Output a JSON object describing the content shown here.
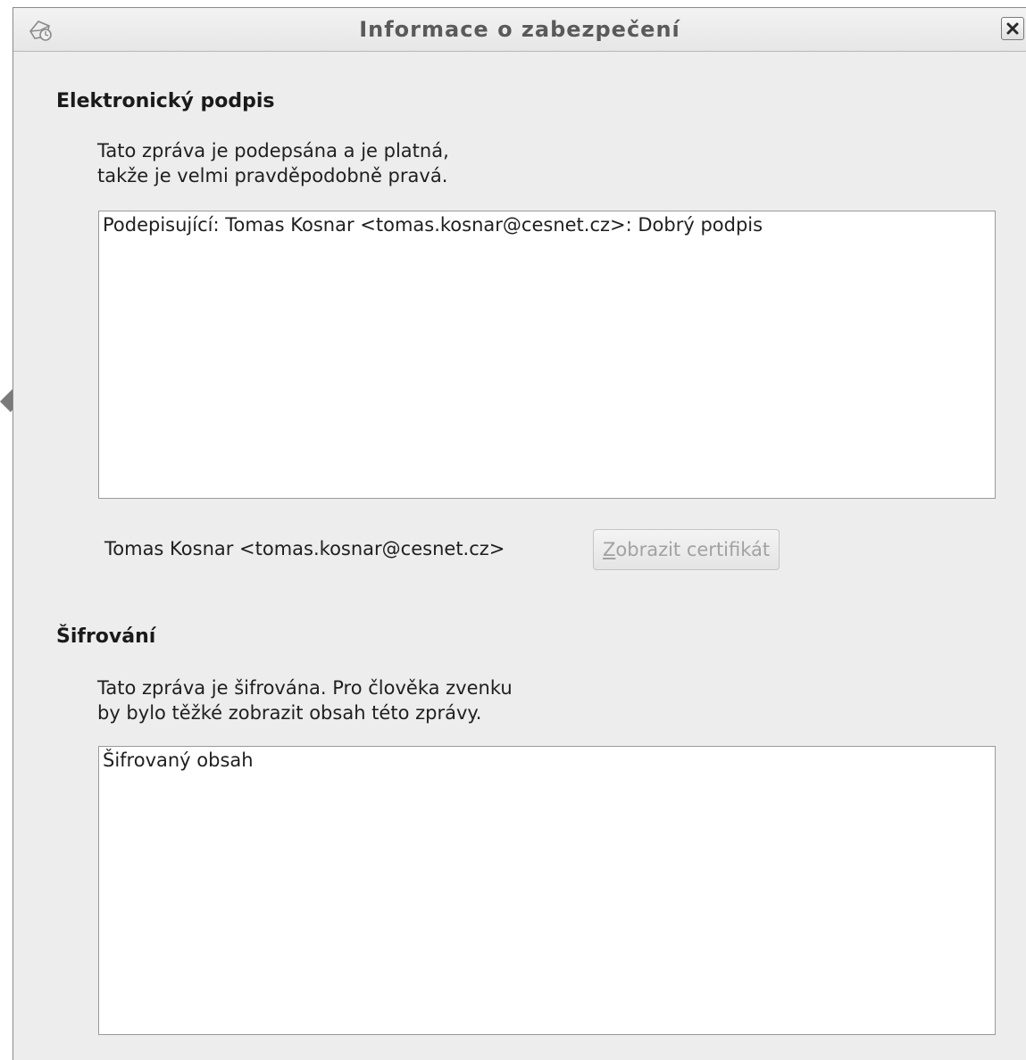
{
  "window": {
    "title": "Informace o zabezpečení",
    "close_label": "×"
  },
  "signature": {
    "heading": "Elektronický podpis",
    "description_line1": "Tato zpráva je podepsána a je platná,",
    "description_line2": "takže je velmi pravděpodobně pravá.",
    "details": "Podepisující: Tomas Kosnar <tomas.kosnar@cesnet.cz>: Dobrý podpis",
    "signer": "Tomas Kosnar <tomas.kosnar@cesnet.cz>",
    "view_cert_button": {
      "mnemonic": "Z",
      "rest": "obrazit certifikát"
    }
  },
  "encryption": {
    "heading": "Šifrování",
    "description_line1": "Tato zpráva je šifrována. Pro člověka zvenku",
    "description_line2": "by bylo těžké zobrazit obsah této zprávy.",
    "details": "Šifrovaný obsah"
  },
  "icons": {
    "window_icon": "security-envelope-icon",
    "close": "close-icon",
    "annotation": "arrow-annotation-icon"
  },
  "colors": {
    "window_bg": "#ededed",
    "arrow": "#7a7a7a",
    "disabled_text": "#a2a2a2"
  }
}
